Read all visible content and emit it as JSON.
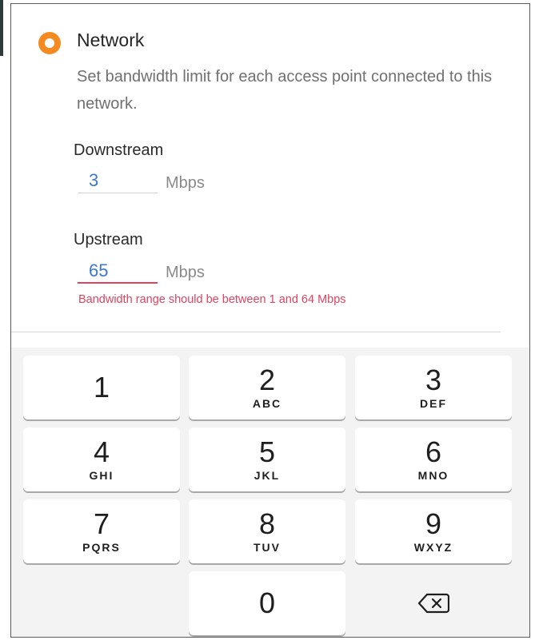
{
  "network": {
    "title": "Network",
    "description": "Set bandwidth limit for each access point connected to this network."
  },
  "downstream": {
    "label": "Downstream",
    "value": "3",
    "unit": "Mbps"
  },
  "upstream": {
    "label": "Upstream",
    "value": "65",
    "unit": "Mbps",
    "error": "Bandwidth range should be between 1 and 64 Mbps"
  },
  "keypad": {
    "keys": [
      {
        "num": "1",
        "letters": ""
      },
      {
        "num": "2",
        "letters": "ABC"
      },
      {
        "num": "3",
        "letters": "DEF"
      },
      {
        "num": "4",
        "letters": "GHI"
      },
      {
        "num": "5",
        "letters": "JKL"
      },
      {
        "num": "6",
        "letters": "MNO"
      },
      {
        "num": "7",
        "letters": "PQRS"
      },
      {
        "num": "8",
        "letters": "TUV"
      },
      {
        "num": "9",
        "letters": "WXYZ"
      },
      {
        "num": "0",
        "letters": ""
      }
    ],
    "backspace_icon": "backspace-icon"
  },
  "colors": {
    "accent": "#f48a20",
    "input_value": "#3d79c7",
    "error": "#e0425f"
  }
}
